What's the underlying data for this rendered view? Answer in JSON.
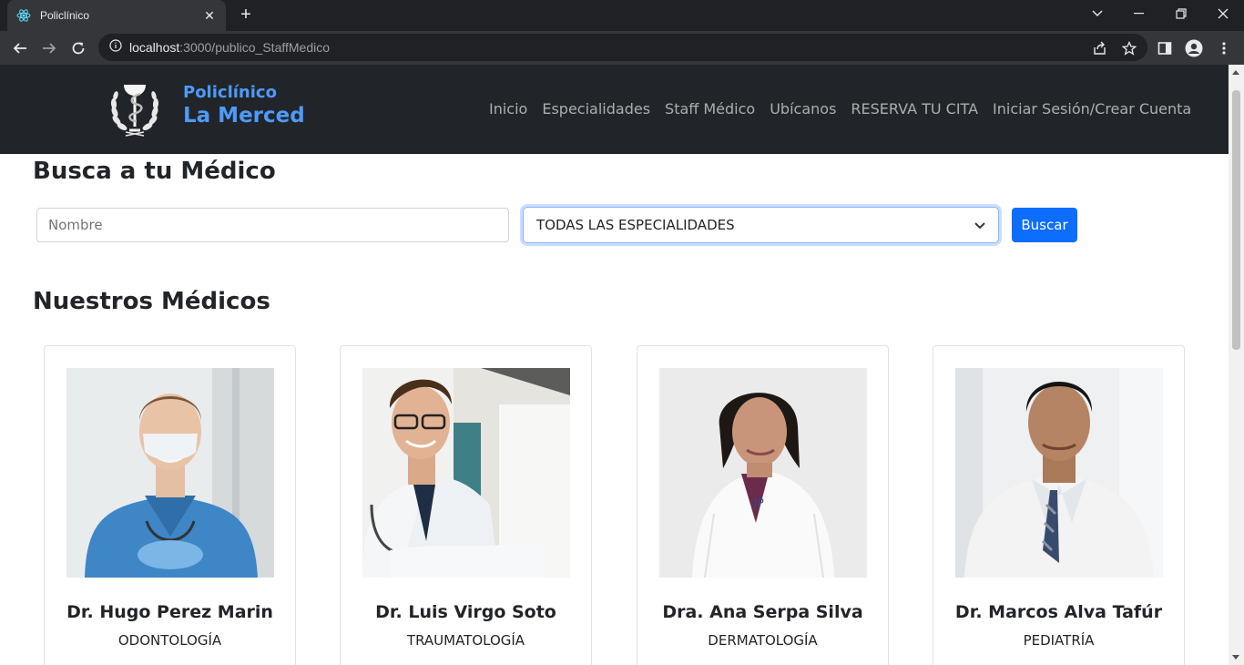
{
  "browser": {
    "tab_title": "Policlínico",
    "tab_close": "✕",
    "new_tab": "+",
    "url_host": "localhost",
    "url_path": ":3000/publico_StaffMedico"
  },
  "site": {
    "brand_line1": "Policlínico",
    "brand_line2": "La Merced",
    "nav": [
      "Inicio",
      "Especialidades",
      "Staff Médico",
      "Ubícanos",
      "RESERVA TU CITA",
      "Iniciar Sesión/Crear Cuenta"
    ]
  },
  "search": {
    "heading": "Busca a tu Médico",
    "name_placeholder": "Nombre",
    "specialty_selected": "TODAS LAS ESPECIALIDADES",
    "button_label": "Buscar"
  },
  "doctors_section": {
    "heading": "Nuestros Médicos",
    "doctors": [
      {
        "name": "Dr. Hugo Perez Marin",
        "specialty": "ODONTOLOGÍA"
      },
      {
        "name": "Dr. Luis Virgo Soto",
        "specialty": "TRAUMATOLOGÍA"
      },
      {
        "name": "Dra. Ana Serpa Silva",
        "specialty": "DERMATOLOGÍA"
      },
      {
        "name": "Dr. Marcos Alva Tafúr",
        "specialty": "PEDIATRÍA"
      }
    ]
  },
  "colors": {
    "navbar_bg": "#212529",
    "brand_blue": "#4e9af8",
    "primary_button": "#0d6efd"
  }
}
